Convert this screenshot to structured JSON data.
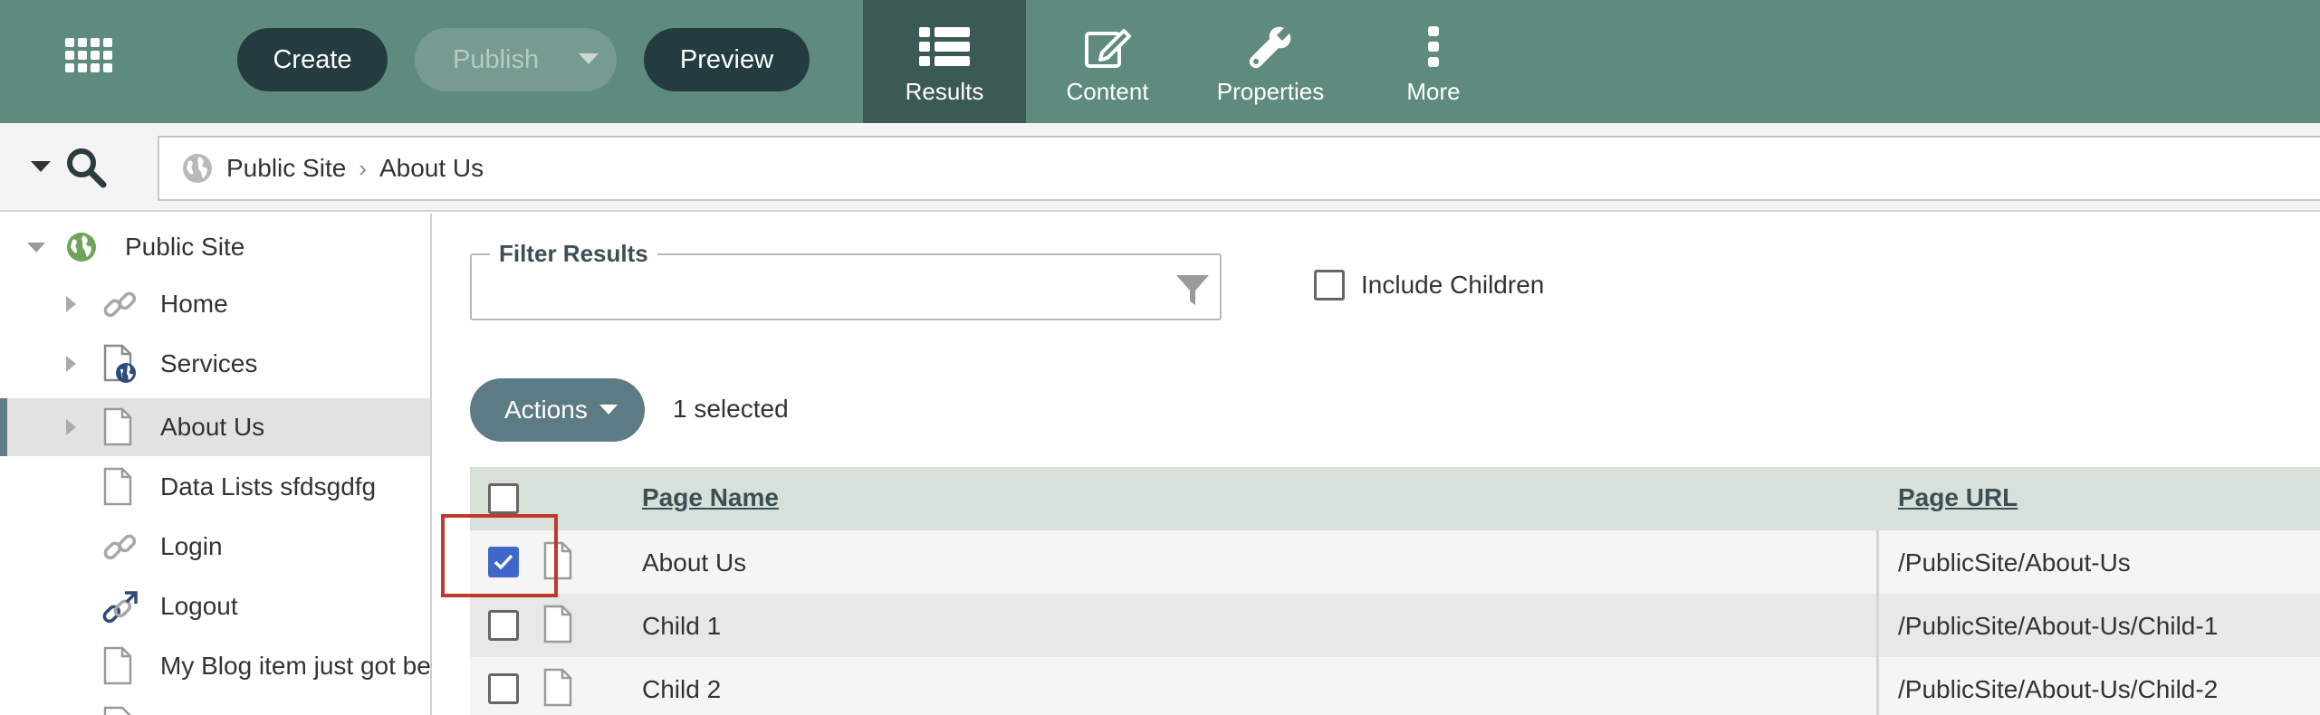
{
  "toolbar": {
    "create_label": "Create",
    "publish_label": "Publish",
    "preview_label": "Preview",
    "tabs": [
      {
        "label": "Results",
        "icon": "list-icon",
        "active": true
      },
      {
        "label": "Content",
        "icon": "edit-icon",
        "active": false
      },
      {
        "label": "Properties",
        "icon": "wrench-icon",
        "active": false
      },
      {
        "label": "More",
        "icon": "more-vertical-icon",
        "active": false
      }
    ]
  },
  "breadcrumb": {
    "items": [
      "Public Site",
      "About Us"
    ]
  },
  "sidebar": {
    "items": [
      {
        "label": "Public Site",
        "icon": "globe-icon"
      },
      {
        "label": "Home",
        "icon": "link-icon"
      },
      {
        "label": "Services",
        "icon": "page-globe-icon"
      },
      {
        "label": "About Us",
        "icon": "page-icon",
        "selected": true
      },
      {
        "label": "Data Lists sfdsgdfg",
        "icon": "page-icon"
      },
      {
        "label": "Login",
        "icon": "link-icon"
      },
      {
        "label": "Logout",
        "icon": "link-arrow-icon"
      },
      {
        "label": "My Blog item just got bet",
        "icon": "page-icon"
      }
    ]
  },
  "filter": {
    "legend": "Filter Results",
    "value": "",
    "placeholder": ""
  },
  "include_children_label": "Include Children",
  "actions_label": "Actions",
  "selected_count_text": "1 selected",
  "table": {
    "columns": [
      "Page Name",
      "Page URL"
    ],
    "rows": [
      {
        "name": "About Us",
        "url": "/PublicSite/About-Us",
        "checked": true
      },
      {
        "name": "Child 1",
        "url": "/PublicSite/About-Us/Child-1",
        "checked": false
      },
      {
        "name": "Child 2",
        "url": "/PublicSite/About-Us/Child-2",
        "checked": false
      }
    ]
  },
  "colors": {
    "toolbar_bg": "#5f8b7e",
    "active_tab_bg": "#3b5a55",
    "dark_button": "#243c3f",
    "checkbox_checked": "#3f66c9",
    "highlight_border": "#c0392b"
  }
}
